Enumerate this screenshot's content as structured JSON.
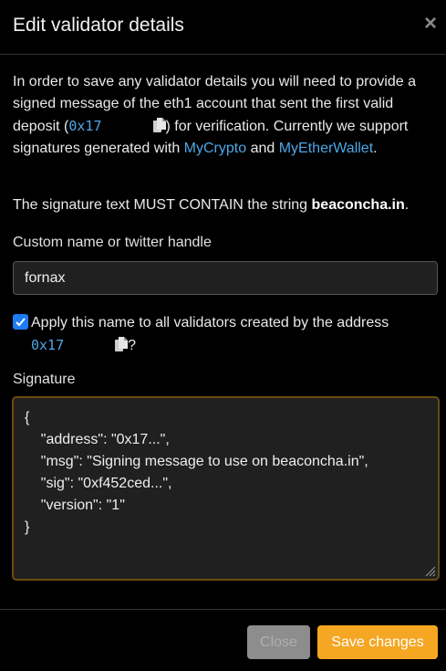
{
  "modal": {
    "title": "Edit validator details",
    "close_icon": "×"
  },
  "intro": {
    "text1": "In order to save any validator details you will need to provide a signed message of the eth1 account that sent the first valid deposit (",
    "address": "0x17",
    "text2": ") for verification. Currently we support signatures generated with ",
    "link1": "MyCrypto",
    "text3": " and ",
    "link2": "MyEtherWallet",
    "text4": "."
  },
  "must_contain": {
    "text": "The signature text MUST CONTAIN the string ",
    "value": "beaconcha.in",
    "end": "."
  },
  "name_field": {
    "label": "Custom name or twitter handle",
    "value": "fornax"
  },
  "apply_all": {
    "checked": true,
    "label": "Apply this name to all validators created by the address",
    "address": "0x17",
    "question": "?"
  },
  "signature": {
    "label": "Signature",
    "value": "{\n    \"address\": \"0x17...\",\n    \"msg\": \"Signing message to use on beaconcha.in\",\n    \"sig\": \"0xf452ced...\",\n    \"version\": \"1\"\n}"
  },
  "footer": {
    "close_label": "Close",
    "save_label": "Save changes"
  },
  "colors": {
    "accent": "#f5a623",
    "link": "#4ea7e8",
    "checkbox": "#1e7cf2"
  }
}
